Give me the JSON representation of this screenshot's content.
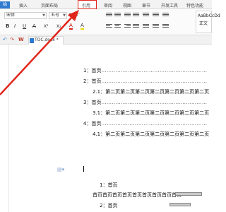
{
  "ribbon_tabs": {
    "start": "始",
    "insert": "插入",
    "page_layout": "页面布局",
    "references": "引用",
    "review": "审阅",
    "view": "视图",
    "section": "章节",
    "developer": "开发工具",
    "special": "特色功能"
  },
  "font": {
    "family": "宋体",
    "size": "五号",
    "grow": "A⁺",
    "shrink": "A⁻"
  },
  "format_buttons": {
    "bold": "B",
    "italic": "I",
    "underline": "U",
    "strike": "A",
    "superscript": "X²",
    "subscript": "X₂",
    "font_color": "A",
    "highlight": "A"
  },
  "style_gallery": {
    "sample": "AaBbCcDd",
    "name": "正文"
  },
  "doc_tab": {
    "name": "TOC.docx *"
  },
  "toc": [
    {
      "num": "1：",
      "text": "首页",
      "dots": "……………………………………………………"
    },
    {
      "num": "2：",
      "text": "首页",
      "dots": "……………………………………………………"
    },
    {
      "num": "2.1：",
      "text": "第二页第二页第二页第二页第二页第二页第二页"
    },
    {
      "num": "3：",
      "text": "首页",
      "dots": "……………………………………………………"
    },
    {
      "num": "3.1：",
      "text": "第二页第二页第二页第二页第二页第二页第二页"
    },
    {
      "num": "4：",
      "text": "首页",
      "dots": "……………………………………………………"
    },
    {
      "num": "4.1：",
      "text": "第二页第二页第二页第二页第二页第二页第二页"
    }
  ],
  "body": [
    {
      "num": "1：",
      "text": "首页"
    },
    {
      "text": "首页首页首页首页首页首页首页首页首页"
    },
    {
      "num": "2：",
      "text": "首页"
    }
  ],
  "colors": {
    "accent": "#e1251b",
    "tab_blue": "#2e7bcf"
  }
}
